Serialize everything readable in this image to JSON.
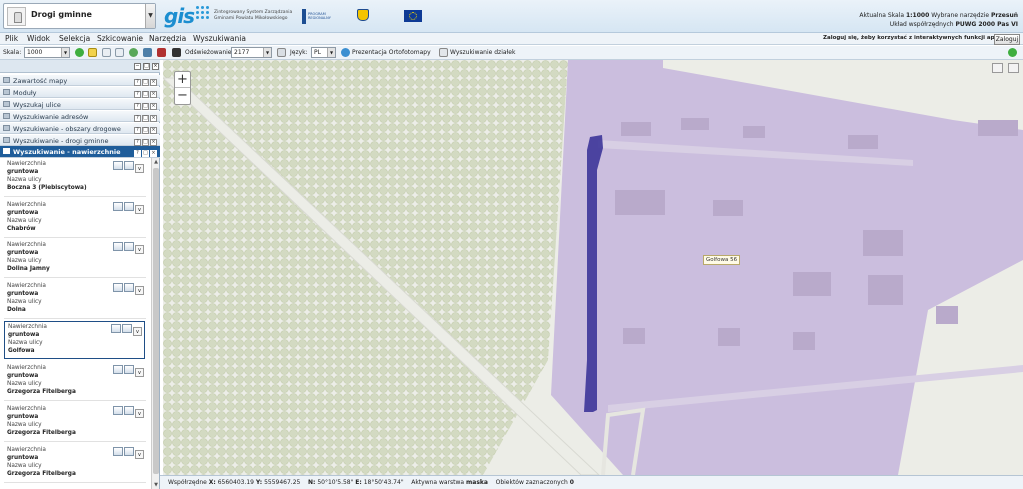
{
  "header": {
    "layer_name": "Drogi gminne",
    "gis_logo": "gis",
    "gis_subtitle": "Zintegrowany System Zarządzania Gminami Powiatu Mikołowskiego",
    "program_logo": "PROGRAM REGIONALNY",
    "scale_label": "Aktualna Skala",
    "scale_value": "1:1000",
    "tool_label": "Wybrane narzędzie",
    "tool_value": "Przesuń",
    "coord_label": "Układ współrzędnych",
    "coord_value": "PUWG 2000 Pas VI"
  },
  "menu": {
    "items": [
      "Plik",
      "Widok",
      "Selekcja",
      "Szkicowanie",
      "Narzędzia",
      "Wyszukiwania"
    ],
    "login_hint": "Zaloguj się, żeby korzystać z interaktywnych funkcji aplikacji",
    "login_button": "Zaloguj"
  },
  "toolbar": {
    "scale_label": "Skala:",
    "scale_value": "1000",
    "refresh_label": "Odświeżowanie:",
    "refresh_value": "2177",
    "lang_label": "Język:",
    "lang_value": "PL",
    "ortho_label": "Prezentacja Ortofotomapy",
    "parcels_label": "Wyszukiwanie działek"
  },
  "panel": {
    "accordion": [
      "Zawartość mapy",
      "Moduły",
      "Wyszukaj ulice",
      "Wyszukiwanie adresów",
      "Wyszukiwanie - obszary drogowe",
      "Wyszukiwanie - drogi gminne"
    ],
    "active_section": "Wyszukiwanie - nawierzchnie",
    "field_surface": "Nawierzchnia",
    "field_street": "Nazwa ulicy",
    "results": [
      {
        "surface": "gruntowa",
        "street": "Boczna 3 (Plebiscytowa)"
      },
      {
        "surface": "gruntowa",
        "street": "Chabrów"
      },
      {
        "surface": "gruntowa",
        "street": "Dolina Jamny"
      },
      {
        "surface": "gruntowa",
        "street": "Dolna"
      },
      {
        "surface": "gruntowa",
        "street": "Golfowa"
      },
      {
        "surface": "gruntowa",
        "street": "Grzegorza Fitelberga"
      },
      {
        "surface": "gruntowa",
        "street": "Grzegorza Fitelberga"
      },
      {
        "surface": "gruntowa",
        "street": "Grzegorza Fitelberga"
      }
    ],
    "selected_index": 4
  },
  "map": {
    "street_label": "Golfowa 56",
    "zoom_in": "+",
    "zoom_out": "−",
    "parcel_color": "#c6b5dc",
    "road_color": "#3d3599"
  },
  "status": {
    "coords_label": "Współrzędne",
    "x_label": "X:",
    "x_value": "6560403.19",
    "y_label": "Y:",
    "y_value": "5559467.25",
    "n_label": "N:",
    "n_value": "50°10'5.58\"",
    "e_label": "E:",
    "e_value": "18°50'43.74\"",
    "layer_label": "Aktywna warstwa",
    "layer_value": "maska",
    "selected_label": "Obiektów zaznaczonych",
    "selected_value": "0"
  }
}
